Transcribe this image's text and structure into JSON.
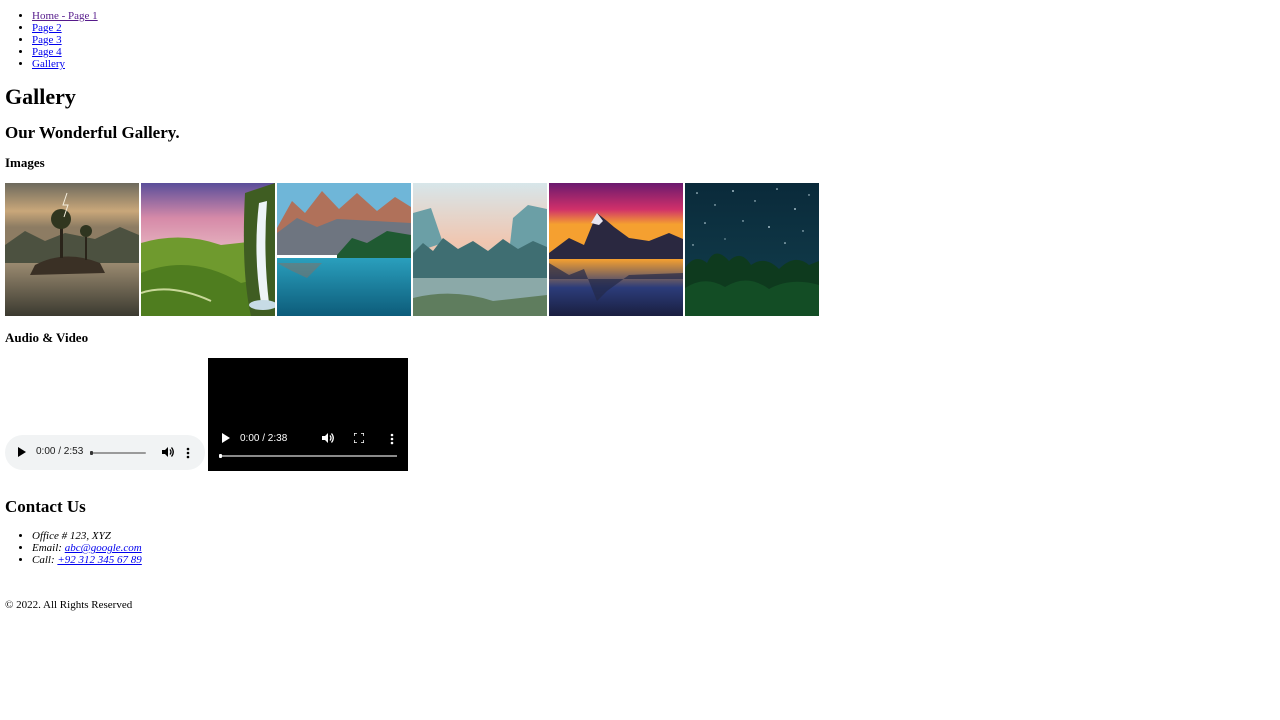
{
  "nav": {
    "items": [
      {
        "label": "Home - Page 1"
      },
      {
        "label": "Page 2"
      },
      {
        "label": "Page 3"
      },
      {
        "label": "Page 4"
      },
      {
        "label": "Gallery"
      }
    ]
  },
  "page": {
    "title": "Gallery",
    "subtitle": "Our Wonderful Gallery."
  },
  "sections": {
    "images_heading": "Images",
    "av_heading": "Audio & Video"
  },
  "gallery": {
    "images": [
      {
        "subject": "lone-tree-lake-storm"
      },
      {
        "subject": "waterfall-green-valley"
      },
      {
        "subject": "mountain-lake-forest"
      },
      {
        "subject": "misty-valley-river"
      },
      {
        "subject": "mountain-sunset-reflection"
      },
      {
        "subject": "starry-night-forest"
      }
    ]
  },
  "audio": {
    "time": "0:00 / 2:53"
  },
  "video": {
    "time": "0:00 / 2:38"
  },
  "contact": {
    "heading": "Contact Us",
    "office": "Office # 123, XYZ",
    "email_label": "Email: ",
    "email": "abc@google.com",
    "call_label": "Call: ",
    "phone": "+92 312 345 67 89"
  },
  "footer": {
    "text": "© 2022. All Rights Reserved"
  },
  "colors": {
    "link": "#0000ee",
    "link_visited": "#551a8b",
    "audio_bg": "#f1f3f4",
    "video_bg": "#000000"
  }
}
